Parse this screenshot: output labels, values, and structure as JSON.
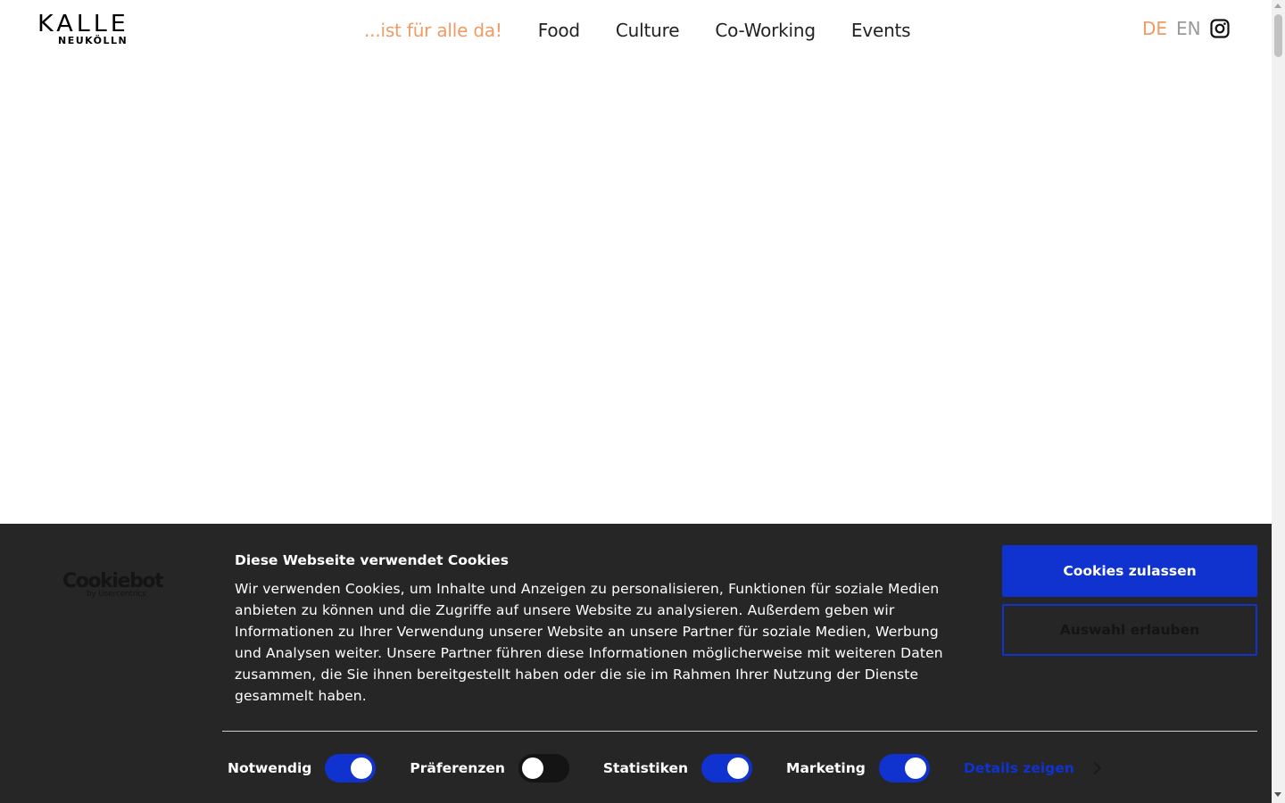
{
  "header": {
    "logo_main": "KALLE",
    "logo_sub": "NEUKÖLLN",
    "nav": [
      {
        "label": "...ist für alle da!"
      },
      {
        "label": "Food"
      },
      {
        "label": "Culture"
      },
      {
        "label": "Co-Working"
      },
      {
        "label": "Events"
      }
    ],
    "lang": {
      "active": "DE",
      "other": "EN"
    },
    "social_icon": "instagram-icon"
  },
  "cookie": {
    "brand": "Cookiebot",
    "brand_sub": "by Usercentrics",
    "title": "Diese Webseite verwendet Cookies",
    "text": "Wir verwenden Cookies, um Inhalte und Anzeigen zu personalisieren, Funktionen für soziale Medien anbieten zu können und die Zugriffe auf unsere Website zu analysieren. Außerdem geben wir Informationen zu Ihrer Verwendung unserer Website an unsere Partner für soziale Medien, Werbung und Analysen weiter. Unsere Partner führen diese Informationen möglicherweise mit weiteren Daten zusammen, die Sie ihnen bereitgestellt haben oder die sie im Rahmen Ihrer Nutzung der Dienste gesammelt haben.",
    "allow_all": "Cookies zulassen",
    "allow_selection": "Auswahl erlauben",
    "toggles": [
      {
        "label": "Notwendig",
        "on": true
      },
      {
        "label": "Präferenzen",
        "on": false
      },
      {
        "label": "Statistiken",
        "on": true
      },
      {
        "label": "Marketing",
        "on": true
      }
    ],
    "details": "Details zeigen"
  },
  "colors": {
    "accent": "#ef9b63",
    "banner_bg": "#262626",
    "primary_blue": "#1032cf"
  }
}
